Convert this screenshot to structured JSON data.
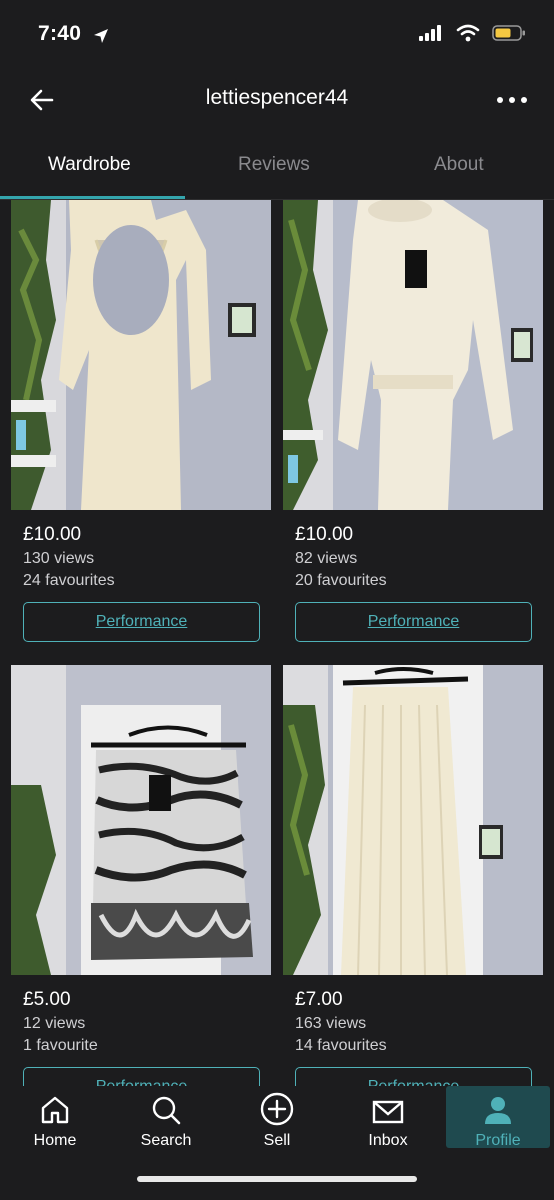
{
  "status": {
    "time": "7:40"
  },
  "header": {
    "title": "lettiespencer44"
  },
  "tabs": [
    {
      "label": "Wardrobe",
      "active": true
    },
    {
      "label": "Reviews",
      "active": false
    },
    {
      "label": "About",
      "active": false
    }
  ],
  "items": [
    {
      "price": "£10.00",
      "views": "130 views",
      "favourites": "24 favourites",
      "button": "Performance",
      "image": "cream-backless-knit-dress-photo"
    },
    {
      "price": "£10.00",
      "views": "82 views",
      "favourites": "20 favourites",
      "button": "Performance",
      "image": "cream-chunky-knit-jumper-dress-photo"
    },
    {
      "price": "£5.00",
      "views": "12 views",
      "favourites": "1 favourite",
      "button": "Performance",
      "image": "zebra-print-mesh-skirt-photo"
    },
    {
      "price": "£7.00",
      "views": "163 views",
      "favourites": "14 favourites",
      "button": "Performance",
      "image": "cream-pleated-trousers-photo"
    }
  ],
  "bottom_nav": [
    {
      "label": "Home",
      "icon": "home-icon",
      "active": false
    },
    {
      "label": "Search",
      "icon": "search-icon",
      "active": false
    },
    {
      "label": "Sell",
      "icon": "plus-circle-icon",
      "active": false
    },
    {
      "label": "Inbox",
      "icon": "mail-icon",
      "active": false
    },
    {
      "label": "Profile",
      "icon": "person-icon",
      "active": true
    }
  ],
  "colors": {
    "accent": "#4fb1b8",
    "background": "#1c1c1e",
    "active_tab_bg": "#1f4a4f",
    "battery": "#f5c842"
  }
}
